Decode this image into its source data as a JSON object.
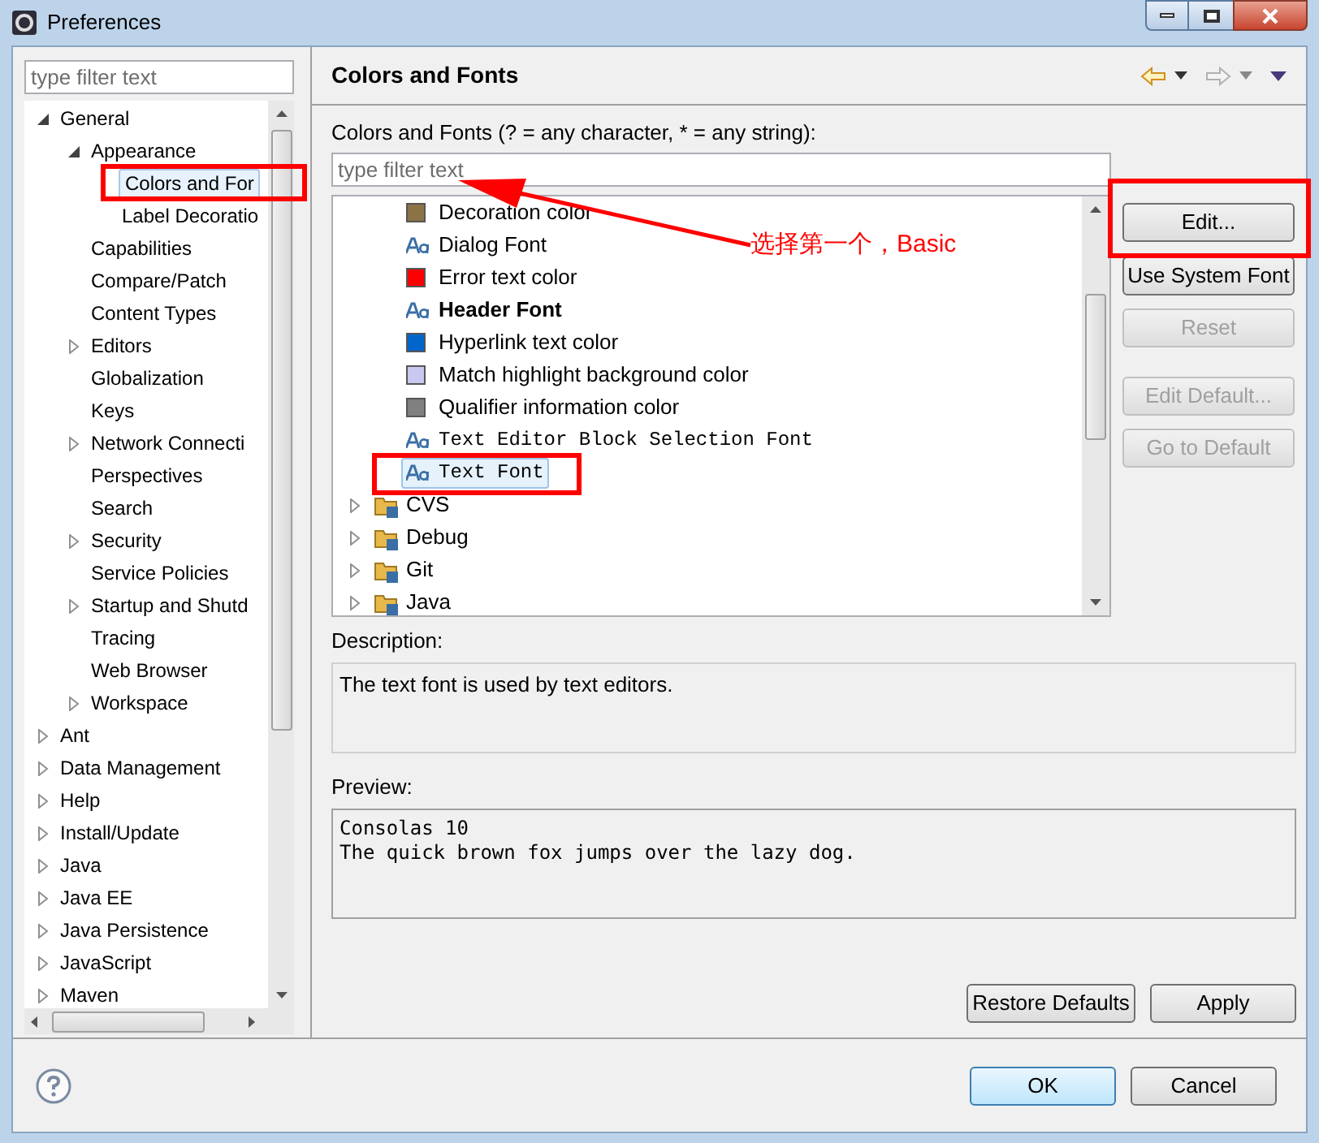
{
  "window": {
    "title": "Preferences"
  },
  "sidebar": {
    "filter": {
      "placeholder": "type filter text"
    },
    "tree": [
      {
        "label": "General",
        "expanded": true,
        "children": [
          {
            "label": "Appearance",
            "expanded": true,
            "children": [
              {
                "label": "Colors and For",
                "selected": true
              },
              {
                "label": "Label Decoratio",
                "selected": false
              }
            ],
            "selected": false
          },
          {
            "label": "Capabilities",
            "selected": false
          },
          {
            "label": "Compare/Patch",
            "selected": false
          },
          {
            "label": "Content Types",
            "selected": false
          },
          {
            "label": "Editors",
            "expanded": false,
            "selected": false
          },
          {
            "label": "Globalization",
            "selected": false
          },
          {
            "label": "Keys",
            "selected": false
          },
          {
            "label": "Network Connecti",
            "expanded": false,
            "selected": false
          },
          {
            "label": "Perspectives",
            "selected": false
          },
          {
            "label": "Search",
            "selected": false
          },
          {
            "label": "Security",
            "expanded": false,
            "selected": false
          },
          {
            "label": "Service Policies",
            "selected": false
          },
          {
            "label": "Startup and Shutd",
            "expanded": false,
            "selected": false
          },
          {
            "label": "Tracing",
            "selected": false
          },
          {
            "label": "Web Browser",
            "selected": false
          },
          {
            "label": "Workspace",
            "expanded": false,
            "selected": false
          }
        ],
        "selected": false
      },
      {
        "label": "Ant",
        "expanded": false,
        "selected": false
      },
      {
        "label": "Data Management",
        "expanded": false,
        "selected": false
      },
      {
        "label": "Help",
        "expanded": false,
        "selected": false
      },
      {
        "label": "Install/Update",
        "expanded": false,
        "selected": false
      },
      {
        "label": "Java",
        "expanded": false,
        "selected": false
      },
      {
        "label": "Java EE",
        "expanded": false,
        "selected": false
      },
      {
        "label": "Java Persistence",
        "expanded": false,
        "selected": false
      },
      {
        "label": "JavaScript",
        "expanded": false,
        "selected": false
      },
      {
        "label": "Maven",
        "expanded": false,
        "selected": false
      }
    ]
  },
  "page": {
    "title": "Colors and Fonts",
    "filter_label": "Colors and Fonts (? = any character, * = any string):",
    "filter": {
      "placeholder": "type filter text"
    },
    "items": [
      {
        "kind": "color",
        "label": "Decoration color",
        "color": "#8b7346",
        "selected": false
      },
      {
        "kind": "font",
        "label": "Dialog Font",
        "selected": false
      },
      {
        "kind": "color",
        "label": "Error text color",
        "color": "#ff0000",
        "selected": false
      },
      {
        "kind": "boldfont",
        "label": "Header Font",
        "selected": false
      },
      {
        "kind": "color",
        "label": "Hyperlink text color",
        "color": "#0066cc",
        "selected": false
      },
      {
        "kind": "color",
        "label": "Match highlight background color",
        "color": "#c8c8f0",
        "selected": false
      },
      {
        "kind": "color",
        "label": "Qualifier information color",
        "color": "#808080",
        "selected": false
      },
      {
        "kind": "monofont",
        "label": "Text Editor Block Selection Font",
        "selected": false
      },
      {
        "kind": "monofont",
        "label": "Text Font",
        "selected": true
      },
      {
        "kind": "folder",
        "label": "CVS",
        "expanded": false,
        "selected": false
      },
      {
        "kind": "folder",
        "label": "Debug",
        "expanded": false,
        "selected": false
      },
      {
        "kind": "folder",
        "label": "Git",
        "expanded": false,
        "selected": false
      },
      {
        "kind": "folder",
        "label": "Java",
        "expanded": false,
        "selected": false
      }
    ],
    "side_buttons": [
      {
        "label": "Edit...",
        "disabled": false
      },
      {
        "label": "Use System Font",
        "disabled": false
      },
      {
        "label": "Reset",
        "disabled": true
      },
      {
        "label": "Edit Default...",
        "disabled": true
      },
      {
        "label": "Go to Default",
        "disabled": true
      }
    ],
    "description_label": "Description:",
    "description": "The text font is used by text editors.",
    "preview_label": "Preview:",
    "preview": [
      "Consolas 10",
      "The quick brown fox jumps over the lazy dog."
    ],
    "buttons": [
      "Restore Defaults",
      "Apply"
    ]
  },
  "dialog_buttons": [
    {
      "label": "OK",
      "default": true
    },
    {
      "label": "Cancel",
      "default": false
    }
  ],
  "annotation": {
    "text": "选择第一个，Basic"
  }
}
